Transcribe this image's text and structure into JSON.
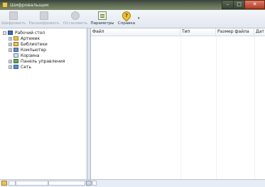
{
  "window": {
    "title": "Шифровальщик",
    "controls": {
      "minimize": "–",
      "maximize": "□",
      "close": "✕"
    }
  },
  "toolbar": {
    "encrypt": "Шифровать",
    "decrypt": "Расшифровать",
    "stop": "Остановить",
    "params": "Параметры",
    "help": "Справка",
    "help_dropdown": "▾"
  },
  "tree": {
    "root": "Рабочий стол",
    "items": [
      {
        "label": "Артемик",
        "icon": "user-folder-icon"
      },
      {
        "label": "Библиотеки",
        "icon": "libraries-icon"
      },
      {
        "label": "Компьютер",
        "icon": "computer-icon"
      },
      {
        "label": "Корзина",
        "icon": "recycle-bin-icon"
      },
      {
        "label": "Панель управления",
        "icon": "control-panel-icon"
      },
      {
        "label": "Сеть",
        "icon": "network-icon"
      }
    ],
    "expand_glyph": "+",
    "collapse_glyph": "−"
  },
  "table": {
    "columns": [
      "Файл",
      "Тип",
      "Размер файла",
      "Дат"
    ]
  },
  "status": {
    "text": ""
  },
  "colors": {
    "title_bar": "#5d6a55",
    "toolbar_bg": "#e8edf3",
    "close_button": "#c7482e",
    "help_icon": "#f1c232"
  }
}
